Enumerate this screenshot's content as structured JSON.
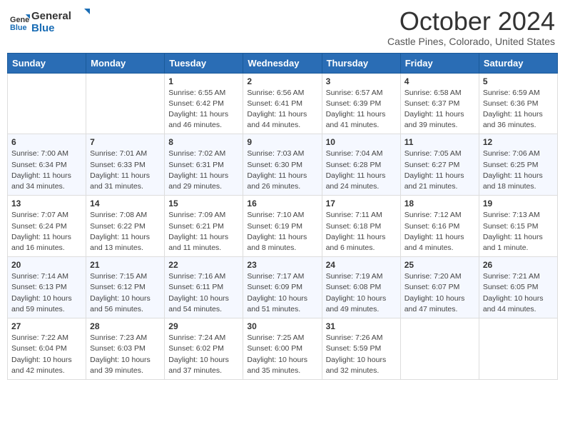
{
  "header": {
    "logo_line1": "General",
    "logo_line2": "Blue",
    "month": "October 2024",
    "location": "Castle Pines, Colorado, United States"
  },
  "days_of_week": [
    "Sunday",
    "Monday",
    "Tuesday",
    "Wednesday",
    "Thursday",
    "Friday",
    "Saturday"
  ],
  "weeks": [
    [
      {
        "day": "",
        "info": ""
      },
      {
        "day": "",
        "info": ""
      },
      {
        "day": "1",
        "info": "Sunrise: 6:55 AM\nSunset: 6:42 PM\nDaylight: 11 hours and 46 minutes."
      },
      {
        "day": "2",
        "info": "Sunrise: 6:56 AM\nSunset: 6:41 PM\nDaylight: 11 hours and 44 minutes."
      },
      {
        "day": "3",
        "info": "Sunrise: 6:57 AM\nSunset: 6:39 PM\nDaylight: 11 hours and 41 minutes."
      },
      {
        "day": "4",
        "info": "Sunrise: 6:58 AM\nSunset: 6:37 PM\nDaylight: 11 hours and 39 minutes."
      },
      {
        "day": "5",
        "info": "Sunrise: 6:59 AM\nSunset: 6:36 PM\nDaylight: 11 hours and 36 minutes."
      }
    ],
    [
      {
        "day": "6",
        "info": "Sunrise: 7:00 AM\nSunset: 6:34 PM\nDaylight: 11 hours and 34 minutes."
      },
      {
        "day": "7",
        "info": "Sunrise: 7:01 AM\nSunset: 6:33 PM\nDaylight: 11 hours and 31 minutes."
      },
      {
        "day": "8",
        "info": "Sunrise: 7:02 AM\nSunset: 6:31 PM\nDaylight: 11 hours and 29 minutes."
      },
      {
        "day": "9",
        "info": "Sunrise: 7:03 AM\nSunset: 6:30 PM\nDaylight: 11 hours and 26 minutes."
      },
      {
        "day": "10",
        "info": "Sunrise: 7:04 AM\nSunset: 6:28 PM\nDaylight: 11 hours and 24 minutes."
      },
      {
        "day": "11",
        "info": "Sunrise: 7:05 AM\nSunset: 6:27 PM\nDaylight: 11 hours and 21 minutes."
      },
      {
        "day": "12",
        "info": "Sunrise: 7:06 AM\nSunset: 6:25 PM\nDaylight: 11 hours and 18 minutes."
      }
    ],
    [
      {
        "day": "13",
        "info": "Sunrise: 7:07 AM\nSunset: 6:24 PM\nDaylight: 11 hours and 16 minutes."
      },
      {
        "day": "14",
        "info": "Sunrise: 7:08 AM\nSunset: 6:22 PM\nDaylight: 11 hours and 13 minutes."
      },
      {
        "day": "15",
        "info": "Sunrise: 7:09 AM\nSunset: 6:21 PM\nDaylight: 11 hours and 11 minutes."
      },
      {
        "day": "16",
        "info": "Sunrise: 7:10 AM\nSunset: 6:19 PM\nDaylight: 11 hours and 8 minutes."
      },
      {
        "day": "17",
        "info": "Sunrise: 7:11 AM\nSunset: 6:18 PM\nDaylight: 11 hours and 6 minutes."
      },
      {
        "day": "18",
        "info": "Sunrise: 7:12 AM\nSunset: 6:16 PM\nDaylight: 11 hours and 4 minutes."
      },
      {
        "day": "19",
        "info": "Sunrise: 7:13 AM\nSunset: 6:15 PM\nDaylight: 11 hours and 1 minute."
      }
    ],
    [
      {
        "day": "20",
        "info": "Sunrise: 7:14 AM\nSunset: 6:13 PM\nDaylight: 10 hours and 59 minutes."
      },
      {
        "day": "21",
        "info": "Sunrise: 7:15 AM\nSunset: 6:12 PM\nDaylight: 10 hours and 56 minutes."
      },
      {
        "day": "22",
        "info": "Sunrise: 7:16 AM\nSunset: 6:11 PM\nDaylight: 10 hours and 54 minutes."
      },
      {
        "day": "23",
        "info": "Sunrise: 7:17 AM\nSunset: 6:09 PM\nDaylight: 10 hours and 51 minutes."
      },
      {
        "day": "24",
        "info": "Sunrise: 7:19 AM\nSunset: 6:08 PM\nDaylight: 10 hours and 49 minutes."
      },
      {
        "day": "25",
        "info": "Sunrise: 7:20 AM\nSunset: 6:07 PM\nDaylight: 10 hours and 47 minutes."
      },
      {
        "day": "26",
        "info": "Sunrise: 7:21 AM\nSunset: 6:05 PM\nDaylight: 10 hours and 44 minutes."
      }
    ],
    [
      {
        "day": "27",
        "info": "Sunrise: 7:22 AM\nSunset: 6:04 PM\nDaylight: 10 hours and 42 minutes."
      },
      {
        "day": "28",
        "info": "Sunrise: 7:23 AM\nSunset: 6:03 PM\nDaylight: 10 hours and 39 minutes."
      },
      {
        "day": "29",
        "info": "Sunrise: 7:24 AM\nSunset: 6:02 PM\nDaylight: 10 hours and 37 minutes."
      },
      {
        "day": "30",
        "info": "Sunrise: 7:25 AM\nSunset: 6:00 PM\nDaylight: 10 hours and 35 minutes."
      },
      {
        "day": "31",
        "info": "Sunrise: 7:26 AM\nSunset: 5:59 PM\nDaylight: 10 hours and 32 minutes."
      },
      {
        "day": "",
        "info": ""
      },
      {
        "day": "",
        "info": ""
      }
    ]
  ]
}
